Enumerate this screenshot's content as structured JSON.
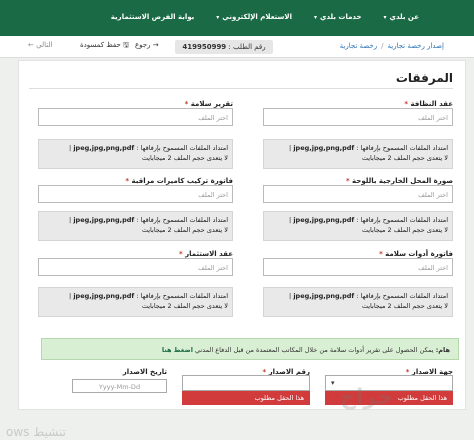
{
  "nav": {
    "items": [
      {
        "label": "عن بلدي"
      },
      {
        "label": "خدمات بلدي"
      },
      {
        "label": "الاستعلام الإلكتروني"
      },
      {
        "label": "بوابة الفرص الاستثمارية"
      }
    ]
  },
  "toolbar": {
    "breadcrumb_root": "إصدار رخصة تجارية",
    "breadcrumb_current": "رخصة تجارية",
    "request_label": "رقم الطلب :",
    "request_number": "419950999",
    "back_label": "رجوع",
    "draft_label": "حفظ كمسودة",
    "next_label": "التالي"
  },
  "section": {
    "title": "المرفقات"
  },
  "select_file_placeholder": "اختر الملف",
  "hint_formats": "jpeg,jpg,png,pdf",
  "hint_prefix": "امتداد الملفات المسموح بإرفاقها :",
  "hint_size": "لا يتعدى حجم الملف 2 ميجابايت",
  "fields": {
    "lease_contract": "عقد النظافة",
    "safety_report": "تقرير سلامة",
    "exterior_photo": "صورة المحل الخارجية باللوحة",
    "camera_invoice": "فاتورة تركيب كاميرات مراقبة",
    "safety_tools_invoice": "فاتورة أدوات سلامة",
    "investment_contract": "عقد الاستثمار"
  },
  "notice": {
    "bold": "هام:",
    "text": "يمكن الحصول على تقرير أدوات سلامة من خلال المكاتب المعتمدة من قبل الدفاع المدني",
    "link": "اضغط هنا"
  },
  "issue": {
    "authority_label": "جهة الاصدار",
    "authority_value": "",
    "number_label": "رقم الاصدار",
    "date_label": "تاريخ الاصدار",
    "date_placeholder": "Yyyy-Mm-Dd",
    "required_error": "هذا الحقل مطلوب"
  },
  "watermark": "ows تنشيط",
  "site_mark": "حراج"
}
